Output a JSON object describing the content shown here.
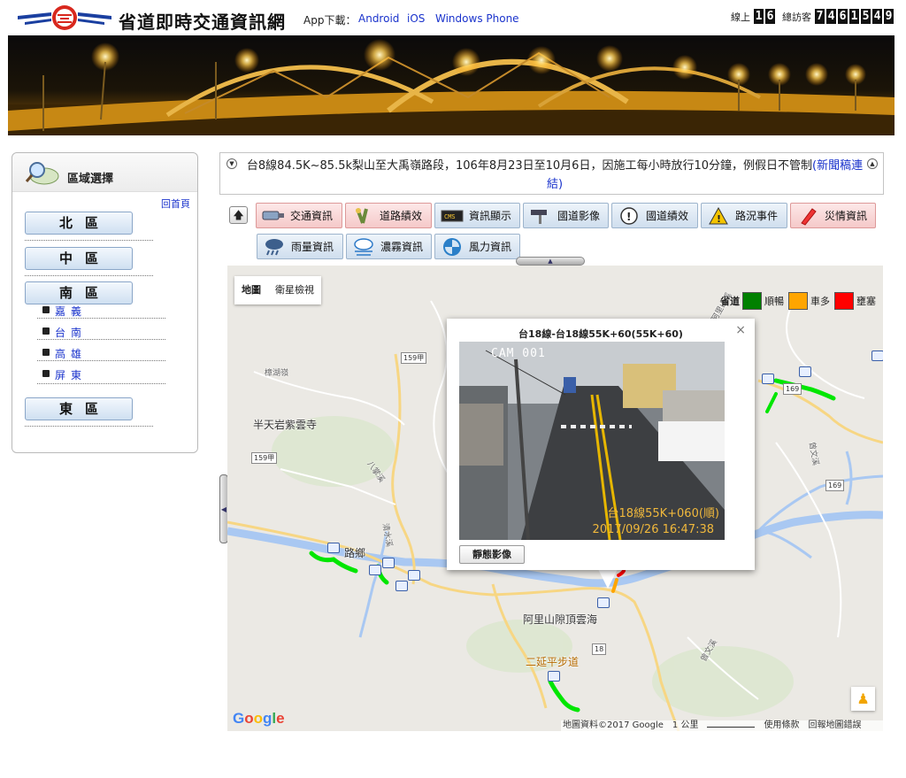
{
  "header": {
    "site_title": "省道即時交通資訊網",
    "app_label": "App下載：",
    "app_links": [
      "Android",
      "iOS",
      "Windows Phone"
    ],
    "online_label": "線上",
    "online_count": "16",
    "visitors_label": "總訪客",
    "visitors_count": "7461549"
  },
  "sidebar": {
    "title": "區域選擇",
    "home_link": "回首頁",
    "regions": [
      {
        "label": "北區"
      },
      {
        "label": "中區"
      },
      {
        "label": "南區",
        "sub_items": [
          "嘉義",
          "台南",
          "高雄",
          "屏東"
        ]
      },
      {
        "label": "東區"
      }
    ]
  },
  "news": {
    "text": "台8線84.5K~85.5k梨山至大禹嶺路段，106年8月23日至10月6日，因施工每小時放行10分鐘，例假日不管制",
    "link": "(新聞稿連結)"
  },
  "tabs": [
    {
      "label": "交通資訊",
      "icon": "camera-icon",
      "style": "red"
    },
    {
      "label": "道路績效",
      "icon": "road-icon",
      "style": "red"
    },
    {
      "label": "資訊顯示",
      "icon": "cms-sign-icon",
      "style": "blue"
    },
    {
      "label": "國道影像",
      "icon": "pole-camera-icon",
      "style": "blue"
    },
    {
      "label": "國道績效",
      "icon": "flower-alert-icon",
      "style": "blue"
    },
    {
      "label": "路況事件",
      "icon": "warning-icon",
      "style": "blue"
    },
    {
      "label": "災情資訊",
      "icon": "pen-icon",
      "style": "red"
    },
    {
      "label": "雨量資訊",
      "icon": "rain-cloud-icon",
      "style": "blue"
    },
    {
      "label": "濃霧資訊",
      "icon": "fog-icon",
      "style": "blue"
    },
    {
      "label": "風力資訊",
      "icon": "wind-icon",
      "style": "blue"
    }
  ],
  "map": {
    "type_buttons": [
      "地圖",
      "衛星檢視"
    ],
    "legend": {
      "title": "省道",
      "items": [
        {
          "label": "順暢",
          "color": "#008000"
        },
        {
          "label": "車多",
          "color": "#ffa500"
        },
        {
          "label": "壅塞",
          "color": "#ff0000"
        }
      ]
    },
    "labels": [
      "半天岩紫雲寺",
      "阿里山隙頂雲海",
      "二延平步道",
      "路鄉",
      "樟湖嶺"
    ],
    "road_shields": [
      "159甲",
      "159甲",
      "169",
      "169",
      "18"
    ],
    "river_labels": [
      "八掌溪",
      "清水溪",
      "曾文溪",
      "曾文溪",
      "阿里山溪"
    ],
    "popup": {
      "title": "台18線-台18線55K+60(55K+60)",
      "camera_overlay": "CAM 001",
      "camera_caption": "台18線55K+060(順)",
      "camera_time": "2017/09/26 16:47:38",
      "static_button": "靜態影像",
      "close": "×"
    },
    "attribution": [
      "地圖資料©2017 Google",
      "1 公里",
      "使用條款",
      "回報地圖錯誤"
    ],
    "google_logo": "Google"
  },
  "colors": {
    "smooth": "#00e600",
    "busy": "#ffa500",
    "jam": "#ff0000",
    "river": "#a9c8f2",
    "link": "#1a33cc"
  }
}
